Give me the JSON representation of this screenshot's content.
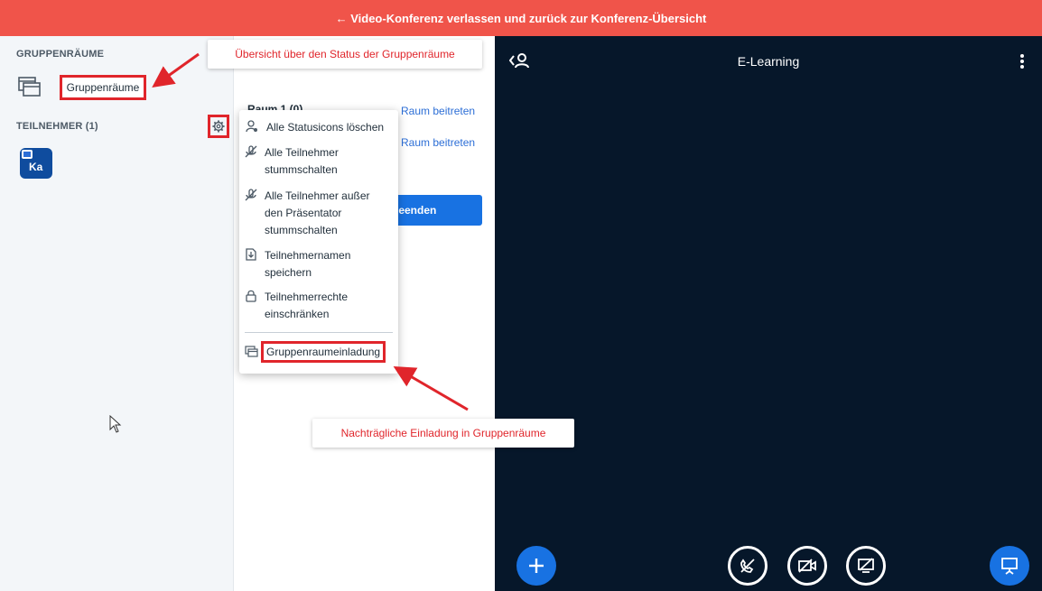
{
  "topbar": {
    "text": "← Video-Konferenz verlassen und zurück zur Konferenz-Übersicht"
  },
  "sidebar": {
    "breakout_heading": "GRUPPENRÄUME",
    "breakout_label": "Gruppenräume",
    "participants_heading": "TEILNEHMER (1)",
    "avatar_initials": "Ka"
  },
  "breakout_panel": {
    "room_title": "Raum 1 (0)",
    "join_link_1": "Raum beitreten",
    "join_link_2": "Raum beitreten",
    "end_button": "beenden"
  },
  "settings_menu": {
    "items": [
      {
        "label": "Alle Statusicons löschen",
        "icon": "clear-status-icon"
      },
      {
        "label": "Alle Teilnehmer stummschalten",
        "icon": "mute-icon"
      },
      {
        "label": "Alle Teilnehmer außer den Präsentator stummschalten",
        "icon": "mute-icon"
      },
      {
        "label": "Teilnehmernamen speichern",
        "icon": "save-icon"
      },
      {
        "label": "Teilnehmerrechte einschränken",
        "icon": "lock-icon"
      }
    ],
    "invite_label": "Gruppenraumeinladung"
  },
  "main": {
    "title": "E-Learning"
  },
  "annotations": {
    "top": "Übersicht über den Status der Gruppenräume",
    "bottom": "Nachträgliche Einladung in Gruppenräume"
  },
  "colors": {
    "topbar": "#f0544a",
    "accent": "#1872e2",
    "annotation": "#e0252b",
    "main_bg": "#06172a"
  }
}
